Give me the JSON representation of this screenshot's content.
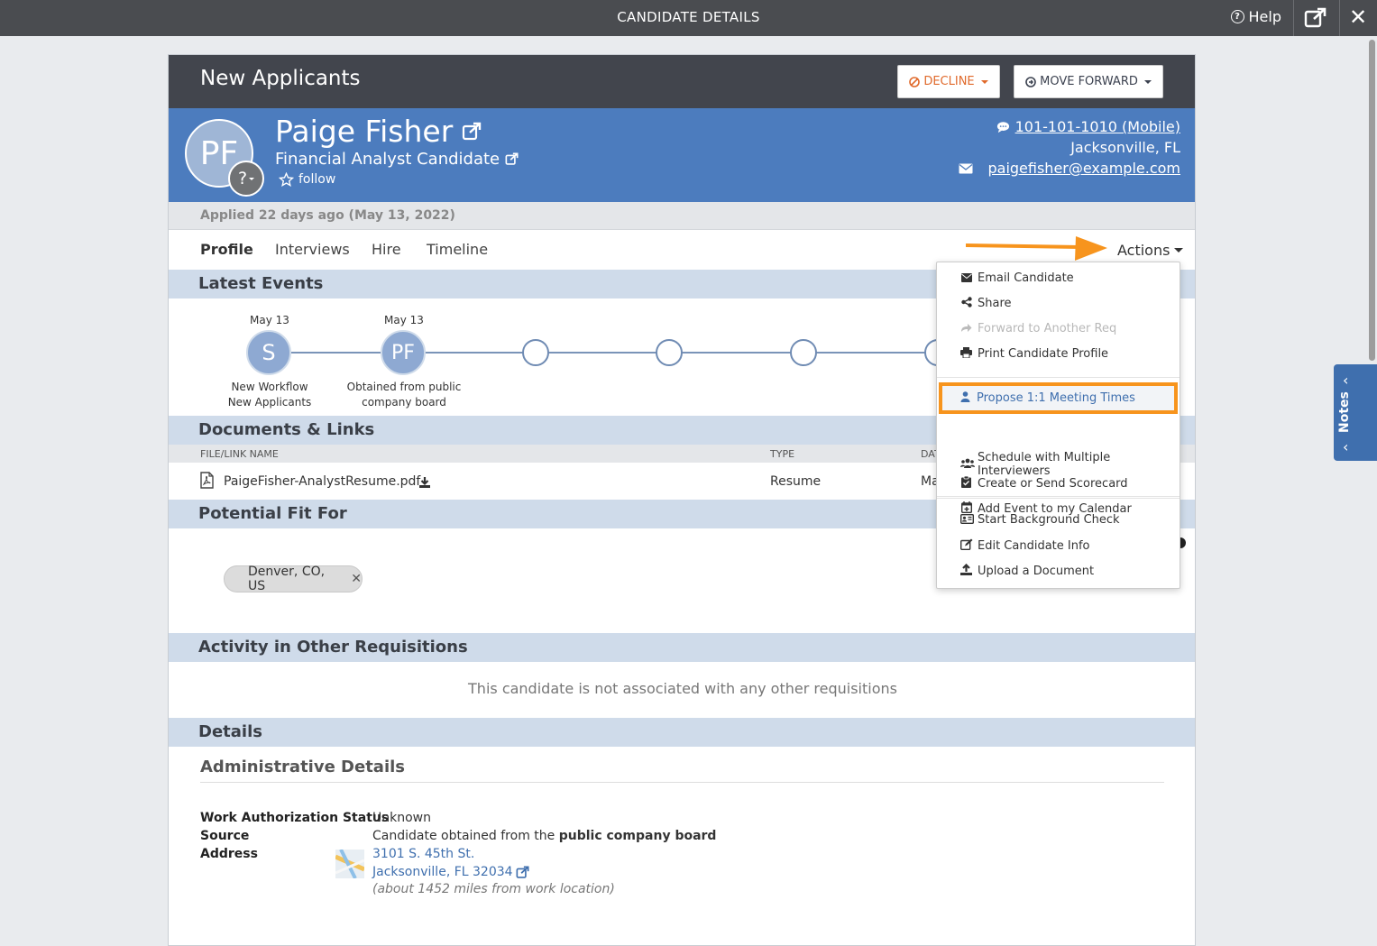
{
  "topbar": {
    "title": "CANDIDATE DETAILS",
    "help": "Help"
  },
  "header": {
    "stage": "New Applicants",
    "decline": "DECLINE",
    "move_forward": "MOVE FORWARD"
  },
  "candidate": {
    "initials": "PF",
    "avatar_q": "?",
    "name": "Paige Fisher",
    "job": "Financial Analyst Candidate",
    "follow": "follow",
    "phone": "101-101-1010 (Mobile)",
    "location": "Jacksonville, FL",
    "email": "paigefisher@example.com"
  },
  "applied": "Applied 22 days ago (May 13, 2022)",
  "tabs": [
    "Profile",
    "Interviews",
    "Hire",
    "Timeline"
  ],
  "actions_label": "Actions",
  "sections": {
    "latest_events": "Latest Events",
    "documents": "Documents & Links",
    "fit": "Potential Fit For",
    "activity": "Activity in Other Requisitions",
    "details": "Details"
  },
  "events": [
    {
      "date": "May 13",
      "initial": "S",
      "label1": "New Workflow",
      "label2": "New Applicants"
    },
    {
      "date": "May 13",
      "initial": "PF",
      "label1": "Obtained from public",
      "label2": "company board"
    }
  ],
  "documents": {
    "columns": {
      "name": "FILE/LINK NAME",
      "type": "TYPE",
      "date": "DAT"
    },
    "rows": [
      {
        "name": "PaigeFisher-AnalystResume.pdf",
        "type": "Resume",
        "date": "Ma"
      }
    ]
  },
  "fit_chip": "Denver, CO, US",
  "activity_empty": "This candidate is not associated with any other requisitions",
  "admin": {
    "title": "Administrative Details",
    "work_auth_label": "Work Authorization Status",
    "work_auth_value": "Unknown",
    "source_label": "Source",
    "source_value_prefix": "Candidate obtained from the ",
    "source_value_bold": "public company board",
    "address_label": "Address",
    "address_line1": "3101 S. 45th St.",
    "address_line2": "Jacksonville, FL 32034",
    "address_distance": "(about 1452 miles from work location)"
  },
  "menu": {
    "group1": [
      "Email Candidate",
      "Share",
      "Forward to Another Req",
      "Print Candidate Profile"
    ],
    "group2": [
      "Propose 1:1 Meeting Times",
      "Schedule with Multiple Interviewers",
      "Create or Send Scorecard",
      "Add Event to my Calendar"
    ],
    "group3": [
      "Start Background Check",
      "Edit Candidate Info",
      "Upload a Document"
    ]
  },
  "notes_label": "Notes",
  "colors": {
    "accent": "#4c7cbe",
    "highlight": "#f7941d",
    "decline": "#e06a2c",
    "header": "#42454d"
  }
}
